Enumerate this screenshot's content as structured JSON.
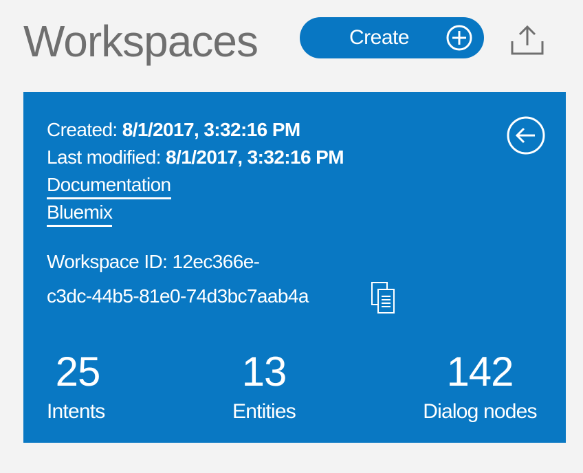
{
  "header": {
    "title": "Workspaces",
    "create_label": "Create"
  },
  "icons": {
    "create": "plus-circle-icon",
    "upload": "upload-icon",
    "back": "arrow-left-circle-icon",
    "copy": "copy-icon"
  },
  "workspace": {
    "created_label": "Created:",
    "created_value": "8/1/2017, 3:32:16 PM",
    "modified_label": "Last modified:",
    "modified_value": "8/1/2017, 3:32:16 PM",
    "links": {
      "documentation": "Documentation",
      "bluemix": "Bluemix"
    },
    "id_line1": "Workspace ID: 12ec366e-",
    "id_line2": "c3dc-44b5-81e0-74d3bc7aab4a",
    "stats": {
      "intents": {
        "value": "25",
        "label": "Intents"
      },
      "entities": {
        "value": "13",
        "label": "Entities"
      },
      "dialog_nodes": {
        "value": "142",
        "label": "Dialog nodes"
      }
    }
  },
  "colors": {
    "accent": "#0877c3",
    "background": "#f3f3f3",
    "title_text": "#6f6f6f",
    "card_text": "#ffffff"
  }
}
